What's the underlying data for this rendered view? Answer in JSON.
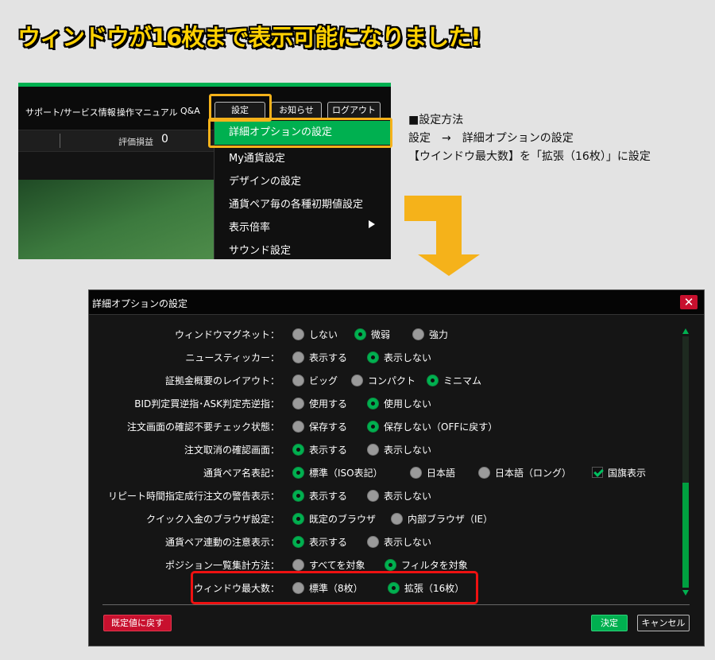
{
  "headline": "ウィンドウが16枚まで表示可能になりました!",
  "app": {
    "nav": [
      "サポート/サービス情報",
      "操作マニュアル",
      "Q&A"
    ],
    "buttons": {
      "settings": "設定",
      "news": "お知らせ",
      "logout": "ログアウト"
    },
    "pnl_label": "評価損益",
    "pnl_value": "0",
    "menu": [
      "詳細オプションの設定",
      "My通貨設定",
      "デザインの設定",
      "通貨ペア毎の各種初期値設定",
      "表示倍率",
      "サウンド設定"
    ]
  },
  "instructions": {
    "heading": "■設定方法",
    "path": "設定　→　詳細オプションの設定",
    "detail": "【ウインドウ最大数】を「拡張（16枚）」に設定"
  },
  "dialog": {
    "title": "詳細オプションの設定",
    "close_glyph": "✕",
    "rows": [
      {
        "label": "ウィンドウマグネット：",
        "options": [
          {
            "text": "しない",
            "on": false
          },
          {
            "text": "微弱",
            "on": true
          },
          {
            "text": "強力",
            "on": false
          }
        ]
      },
      {
        "label": "ニュースティッカー：",
        "options": [
          {
            "text": "表示する",
            "on": false
          },
          {
            "text": "表示しない",
            "on": true
          }
        ]
      },
      {
        "label": "証拠金概要のレイアウト：",
        "options": [
          {
            "text": "ビッグ",
            "on": false
          },
          {
            "text": "コンパクト",
            "on": false
          },
          {
            "text": "ミニマム",
            "on": true
          }
        ]
      },
      {
        "label": "BID判定買逆指･ASK判定売逆指：",
        "options": [
          {
            "text": "使用する",
            "on": false
          },
          {
            "text": "使用しない",
            "on": true
          }
        ]
      },
      {
        "label": "注文画面の確認不要チェック状態：",
        "options": [
          {
            "text": "保存する",
            "on": false
          },
          {
            "text": "保存しない（OFFに戻す）",
            "on": true
          }
        ]
      },
      {
        "label": "注文取消の確認画面：",
        "options": [
          {
            "text": "表示する",
            "on": true
          },
          {
            "text": "表示しない",
            "on": false
          }
        ]
      },
      {
        "label": "通貨ペア名表記：",
        "options": [
          {
            "text": "標準（ISO表記）",
            "on": true
          },
          {
            "text": "日本語",
            "on": false
          },
          {
            "text": "日本語（ロング）",
            "on": false
          }
        ],
        "checkbox": {
          "text": "国旗表示",
          "on": true
        }
      },
      {
        "label": "リピート時間指定成行注文の警告表示：",
        "options": [
          {
            "text": "表示する",
            "on": true
          },
          {
            "text": "表示しない",
            "on": false
          }
        ]
      },
      {
        "label": "クイック入金のブラウザ設定：",
        "options": [
          {
            "text": "既定のブラウザ",
            "on": true
          },
          {
            "text": "内部ブラウザ（IE）",
            "on": false
          }
        ]
      },
      {
        "label": "通貨ペア連動の注意表示：",
        "options": [
          {
            "text": "表示する",
            "on": true
          },
          {
            "text": "表示しない",
            "on": false
          }
        ]
      },
      {
        "label": "ポジション一覧集計方法：",
        "options": [
          {
            "text": "すべてを対象",
            "on": false
          },
          {
            "text": "フィルタを対象",
            "on": true
          }
        ]
      },
      {
        "label": "ウィンドウ最大数：",
        "options": [
          {
            "text": "標準（8枚）",
            "on": false
          },
          {
            "text": "拡張（16枚）",
            "on": true
          }
        ]
      }
    ],
    "buttons": {
      "reset": "既定値に戻す",
      "ok": "決定",
      "cancel": "キャンセル"
    }
  },
  "colors": {
    "accent": "#00b050",
    "highlight": "#f5b21a",
    "alert": "#ee1111",
    "headline": "#ffd100"
  }
}
